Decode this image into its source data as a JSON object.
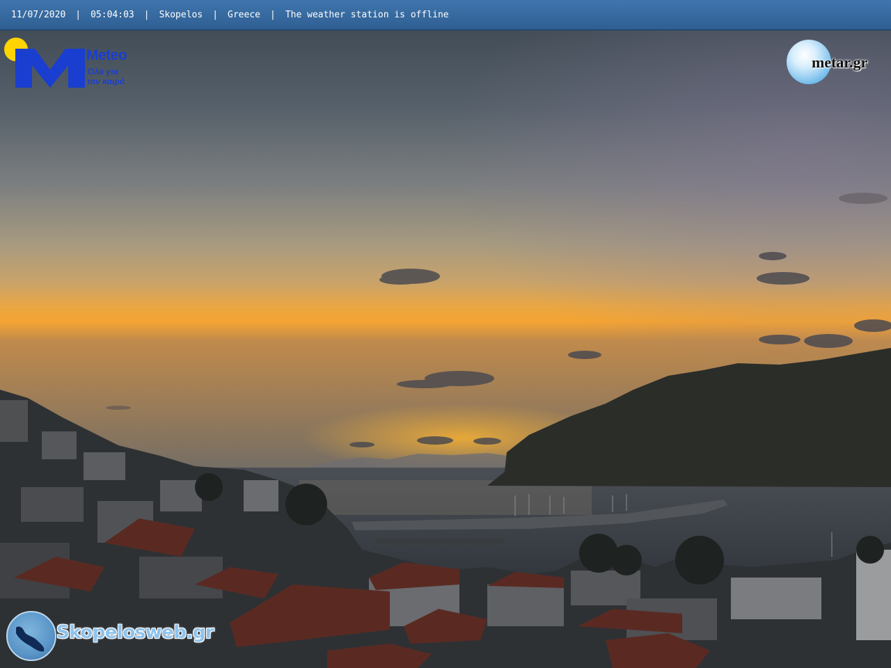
{
  "status_bar": {
    "date": "11/07/2020",
    "time": "05:04:03",
    "location": "Skopelos",
    "country": "Greece",
    "station_status": "The weather station is offline",
    "separator": "|"
  },
  "logos": {
    "meteo": {
      "name": "Meteo",
      "tagline_line1": "Όλα για",
      "tagline_line2": "τον καιρό"
    },
    "metar": {
      "name": "metar.gr"
    },
    "skopelosweb": {
      "name": "Skopelosweb.gr"
    }
  },
  "colors": {
    "bar_blue": "#2f5f93",
    "meteo_blue": "#1a3ed0",
    "sun_yellow": "#ffd400",
    "sky_top": "#3f4a55",
    "sky_horizon": "#f3a83a"
  }
}
